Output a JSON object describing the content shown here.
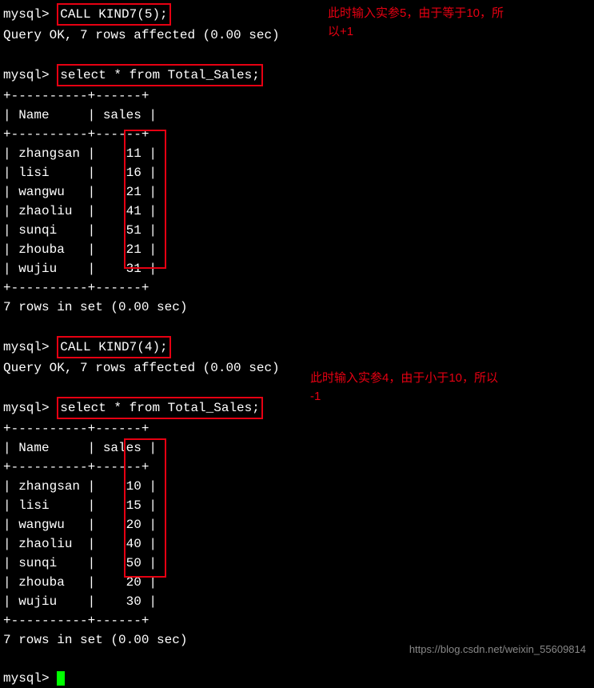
{
  "prompt": "mysql>",
  "call1": "CALL KIND7(5);",
  "result1": "Query OK, 7 rows affected (0.00 sec)",
  "annotation1_line1": "此时输入实参5，由于等于10，所",
  "annotation1_line2": "以+1",
  "select1": "select * from Total_Sales;",
  "table_border": "+----------+------+",
  "table_header": "| Name     | sales |",
  "table1": {
    "rows": [
      {
        "name": "zhangsan",
        "sales": "11"
      },
      {
        "name": "lisi",
        "sales": "16"
      },
      {
        "name": "wangwu",
        "sales": "21"
      },
      {
        "name": "zhaoliu",
        "sales": "41"
      },
      {
        "name": "sunqi",
        "sales": "51"
      },
      {
        "name": "zhouba",
        "sales": "21"
      },
      {
        "name": "wujiu",
        "sales": "31"
      }
    ]
  },
  "rows_result": "7 rows in set (0.00 sec)",
  "call2": "CALL KIND7(4);",
  "result2": "Query OK, 7 rows affected (0.00 sec)",
  "select2": "select * from Total_Sales;",
  "annotation2_line1": "此时输入实参4，由于小于10，所以",
  "annotation2_line2": "-1",
  "table2": {
    "rows": [
      {
        "name": "zhangsan",
        "sales": "10"
      },
      {
        "name": "lisi",
        "sales": "15"
      },
      {
        "name": "wangwu",
        "sales": "20"
      },
      {
        "name": "zhaoliu",
        "sales": "40"
      },
      {
        "name": "sunqi",
        "sales": "50"
      },
      {
        "name": "zhouba",
        "sales": "20"
      },
      {
        "name": "wujiu",
        "sales": "30"
      }
    ]
  },
  "watermark": "https://blog.csdn.net/weixin_55609814"
}
